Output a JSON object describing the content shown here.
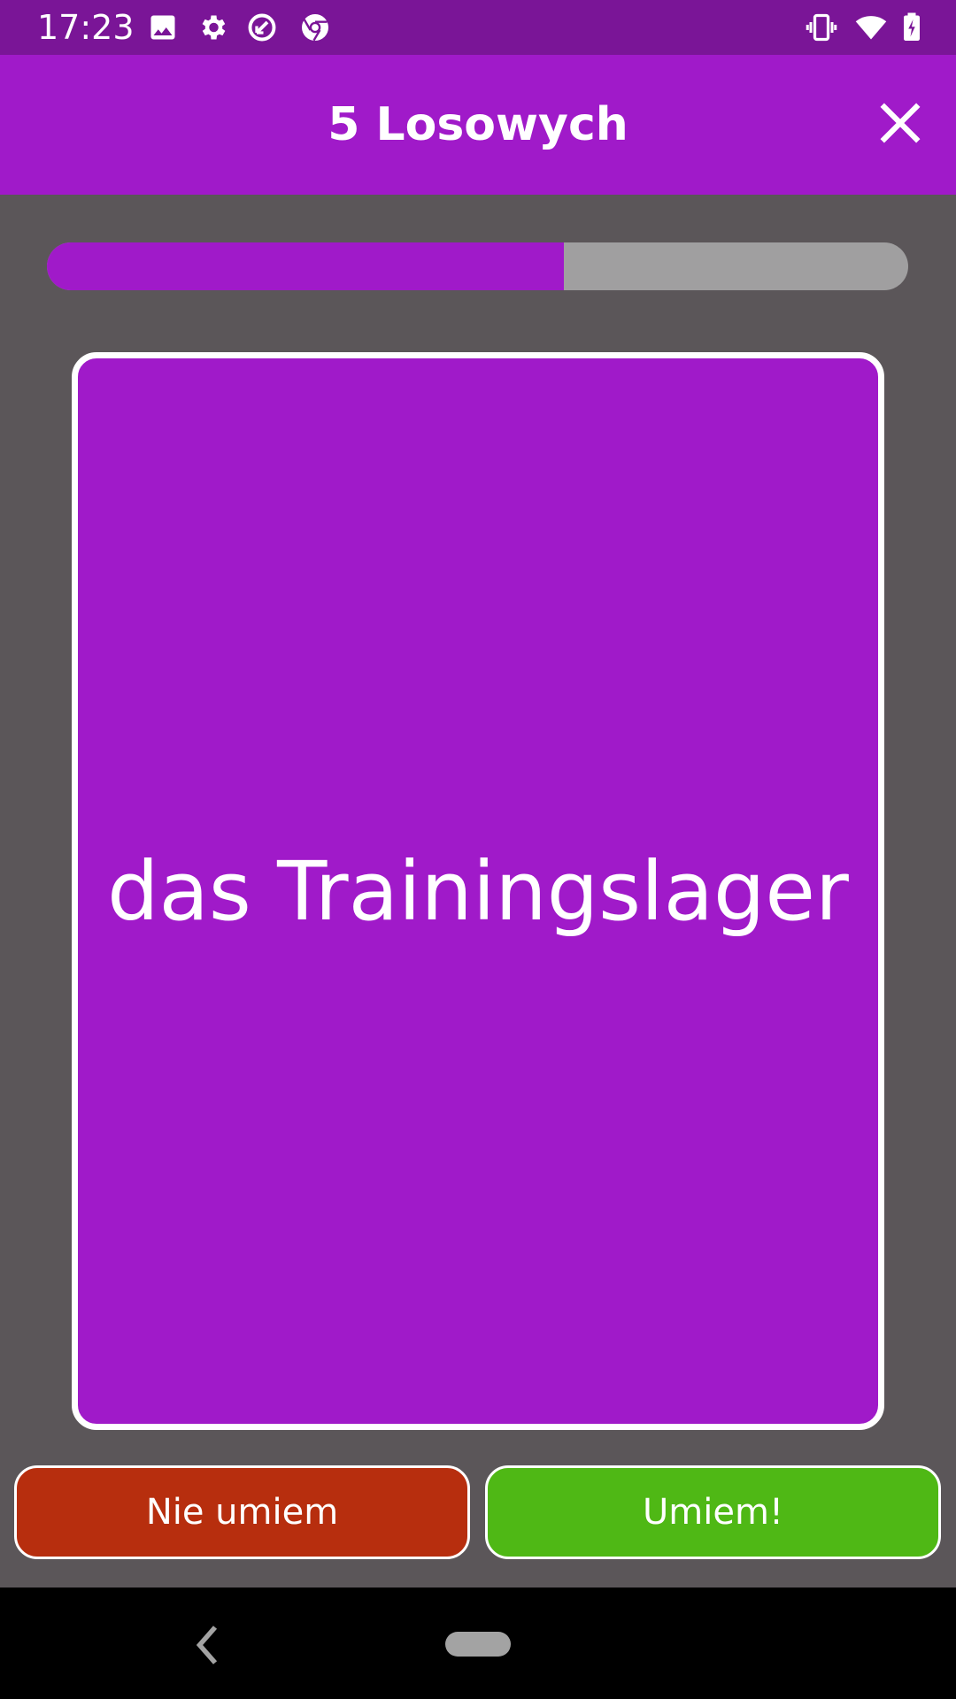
{
  "status_bar": {
    "time": "17:23",
    "left_icons": [
      "image-icon",
      "gear-icon",
      "data-saver-icon",
      "chrome-icon"
    ],
    "right_icons": [
      "vibrate-icon",
      "wifi-icon",
      "battery-charging-icon"
    ]
  },
  "app_bar": {
    "title": "5 Losowych",
    "close_icon": "close-icon"
  },
  "progress": {
    "fraction": 0.6
  },
  "flashcard": {
    "word": "das Trainingslager"
  },
  "buttons": {
    "dont_know": "Nie umiem",
    "know": "Umiem!"
  },
  "nav_bar": {
    "back_icon": "back-chevron-icon",
    "home_icon": "home-pill-icon"
  },
  "colors": {
    "status_bar": "#7a1597",
    "accent": "#a01ac9",
    "background": "#5b5659",
    "progress_track": "#a09fa0",
    "dont_know_button": "#b72e0e",
    "know_button": "#4fb815"
  }
}
